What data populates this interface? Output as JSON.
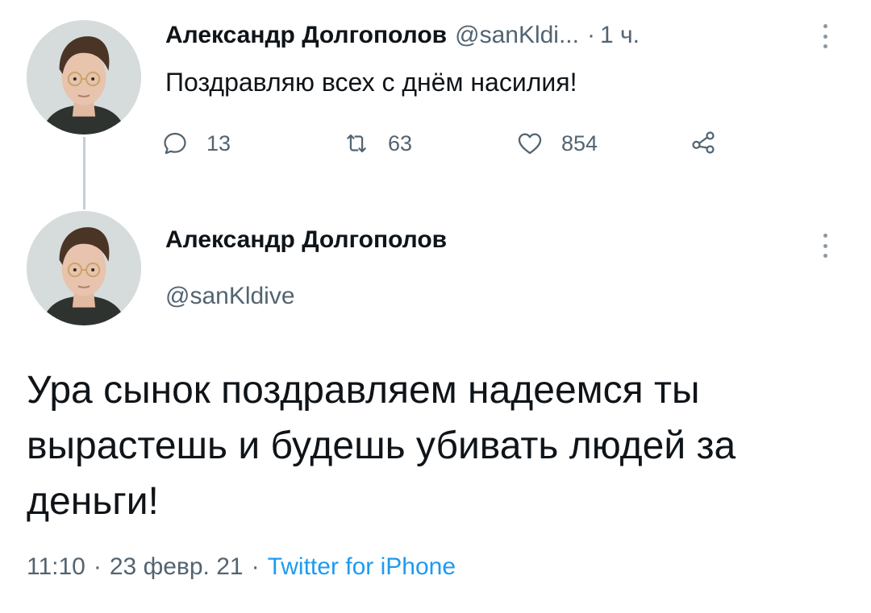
{
  "tweet1": {
    "author_name": "Александр Долгополов",
    "handle": "@sanKldi...",
    "separator": "·",
    "time_ago": "1 ч.",
    "text": "Поздравляю всех с днём насилия!",
    "actions": {
      "reply_count": "13",
      "retweet_count": "63",
      "like_count": "854"
    }
  },
  "tweet2": {
    "author_name": "Александр Долгополов",
    "handle": "@sanKldive",
    "text": "Ура сынок поздравляем надеемся ты вырастешь и будешь убивать людей за деньги!",
    "time": "11:10",
    "separator": "·",
    "date": "23 февр. 21",
    "source": "Twitter for iPhone"
  },
  "icons": {
    "reply": "reply-icon",
    "retweet": "retweet-icon",
    "like": "heart-icon",
    "share": "share-icon",
    "more": "more-vertical-icon"
  },
  "colors": {
    "text_primary": "#0f1419",
    "text_secondary": "#536471",
    "link": "#1d9bf0",
    "thread_line": "#c4cfd6"
  }
}
